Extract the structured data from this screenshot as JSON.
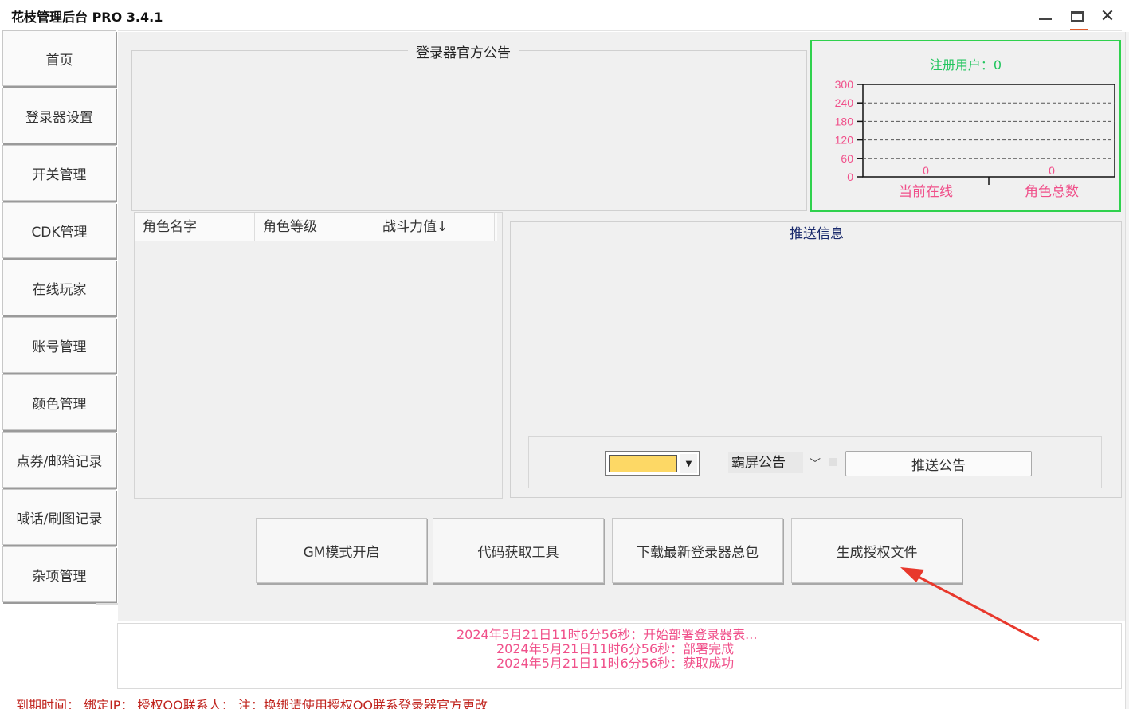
{
  "window": {
    "title": "花枝管理后台 PRO 3.4.1"
  },
  "sidebar": {
    "items": [
      {
        "label": "首页"
      },
      {
        "label": "登录器设置"
      },
      {
        "label": "开关管理"
      },
      {
        "label": "CDK管理"
      },
      {
        "label": "在线玩家"
      },
      {
        "label": "账号管理"
      },
      {
        "label": "颜色管理"
      },
      {
        "label": "点券/邮箱记录"
      },
      {
        "label": "喊话/刷图记录"
      },
      {
        "label": "杂项管理"
      }
    ]
  },
  "notice": {
    "title": "登录器官方公告"
  },
  "stats_chart": {
    "title": "注册用户：0",
    "colors": {
      "border": "#2fd14d",
      "title": "#22c55e",
      "labels": "#f0508a"
    }
  },
  "chart_data": {
    "type": "bar",
    "categories": [
      "当前在线",
      "角色总数"
    ],
    "values": [
      0,
      0
    ],
    "ylim": [
      0,
      300
    ],
    "yticks": [
      "0",
      "60",
      "120",
      "180",
      "240",
      "300"
    ],
    "grid": true
  },
  "player_table": {
    "columns": [
      "角色名字",
      "角色等级",
      "战斗力值↓"
    ],
    "rows": []
  },
  "push_panel": {
    "title": "推送信息",
    "color_value": "#fdd865",
    "type_selected": "霸屏公告",
    "push_button": "推送公告"
  },
  "actions": [
    {
      "label": "GM模式开启"
    },
    {
      "label": "代码获取工具"
    },
    {
      "label": "下载最新登录器总包"
    },
    {
      "label": "生成授权文件"
    }
  ],
  "log": {
    "lines": [
      "2024年5月21日11时6分56秒：开始部署登录器表...",
      "2024年5月21日11时6分56秒：部署完成",
      "2024年5月21日11时6分56秒：获取成功"
    ]
  },
  "status_bar": {
    "text": "到期时间：  绑定IP：  授权QQ联系人：  注：换绑请使用授权QQ联系登录器官方更改"
  }
}
